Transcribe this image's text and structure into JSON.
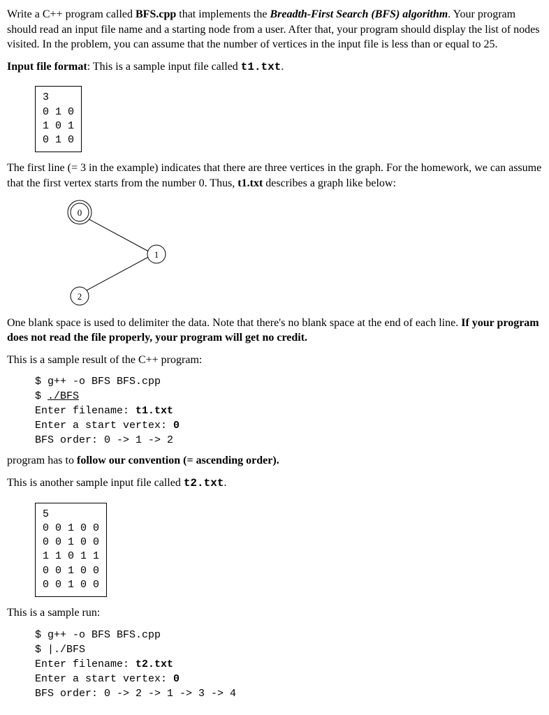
{
  "para1_a": "Write a C++ program called ",
  "para1_b": "BFS.cpp",
  "para1_c": " that implements the ",
  "para1_d": "Breadth-First Search (BFS) algorithm",
  "para1_e": ". Your program should read an input file name and a starting node from a user. After that, your program should display the list of nodes visited. In the problem, you can assume that the number of vertices in the input file is less than or equal to 25.",
  "para2_a": "Input file format",
  "para2_b": ": This is a sample input file called ",
  "para2_c": "t1.txt",
  "para2_d": ".",
  "box1": "3\n0 1 0\n1 0 1\n0 1 0",
  "para3_a": "The first line (= 3 in the example) indicates that there are three vertices in the graph. For the homework, we can assume that the first vertex starts from the number 0. Thus, ",
  "para3_b": "t1.txt",
  "para3_c": " describes a graph like below:",
  "graph": {
    "node0": "0",
    "node1": "1",
    "node2": "2"
  },
  "para4_a": "One blank space is used to delimiter the data. Note that there's no blank space at the end of each line. ",
  "para4_b": "If your program does not read the file properly, your program will get no credit.",
  "para5": "This is a sample result of the C++ program:",
  "term1_l1": "$ g++ -o BFS BFS.cpp",
  "term1_l2a": "$ ",
  "term1_l2b": "./BFS",
  "term1_l3a": "Enter filename: ",
  "term1_l3b": "t1.txt",
  "term1_l4a": "Enter a start vertex: ",
  "term1_l4b": "0",
  "term1_l5": "BFS order: 0 -> 1 -> 2",
  "para6_a": "program has to ",
  "para6_b": "follow our convention (= ascending order).",
  "para7_a": "This is another sample input file called ",
  "para7_b": "t2.txt",
  "para7_c": ".",
  "box2": "5\n0 0 1 0 0\n0 0 1 0 0\n1 1 0 1 1\n0 0 1 0 0\n0 0 1 0 0",
  "para8": "This is a sample run:",
  "term2_l1": "$ g++ -o BFS BFS.cpp",
  "term2_l2": "$ |./BFS",
  "term2_l3a": "Enter filename: ",
  "term2_l3b": "t2.txt",
  "term2_l4a": "Enter a start vertex: ",
  "term2_l4b": "0",
  "term2_l5": "BFS order: 0 -> 2 -> 1 -> 3 -> 4"
}
